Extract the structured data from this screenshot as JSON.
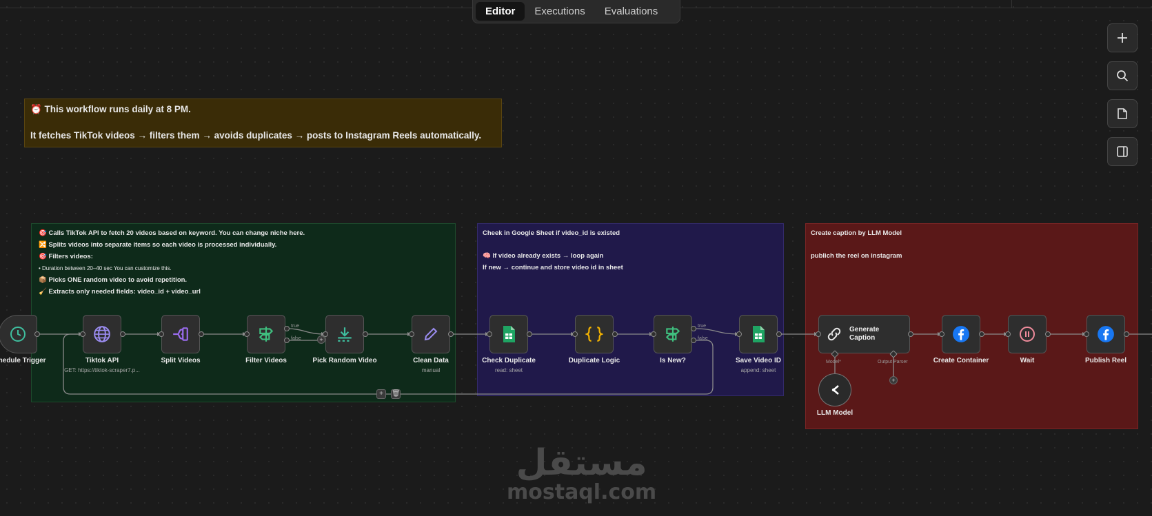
{
  "tabs": [
    {
      "label": "Editor",
      "active": true
    },
    {
      "label": "Executions",
      "active": false
    },
    {
      "label": "Evaluations",
      "active": false
    }
  ],
  "right_toolbar": [
    "plus-icon",
    "search-icon",
    "sticky-note-icon",
    "panel-icon"
  ],
  "notes": {
    "top": {
      "line1": "⏰ This workflow runs daily at 8 PM.",
      "line2": "It fetches TikTok videos → filters them → avoids duplicates → posts to Instagram Reels automatically."
    },
    "green": {
      "l1": "🎯 Calls TikTok API to fetch 20 videos based on keyword. You can change niche here.",
      "l2": "🔀 Splits videos into separate items so each video is processed individually.",
      "l3": "🎯 Filters videos:",
      "l4": "•  Duration between 20–40 sec You can customize this.",
      "l5": "📦 Picks ONE random video to avoid repetition.",
      "l6": "🧹 Extracts only needed fields: video_id + video_url"
    },
    "blue": {
      "l1": "Cheek in Google Sheet if video_id is existed",
      "l2": "🧠 If video already exists → loop again",
      "l3": "If new → continue and store video id in sheet"
    },
    "red": {
      "l1": "Create caption by LLM Model",
      "l2": "publich the reel on instagram"
    }
  },
  "nodes": {
    "schedule": {
      "label": "Schedule Trigger",
      "icon": "clock-icon"
    },
    "tiktok": {
      "label": "Tiktok API",
      "sub": "GET: https://tiktok-scraper7.p...",
      "icon": "globe-icon"
    },
    "split": {
      "label": "Split Videos",
      "icon": "split-icon"
    },
    "filter": {
      "label": "Filter Videos",
      "icon": "signpost-icon",
      "true_label": "true",
      "false_label": "false"
    },
    "random": {
      "label": "Pick Random Video",
      "icon": "download-icon"
    },
    "clean": {
      "label": "Clean Data",
      "sub": "manual",
      "icon": "pencil-icon"
    },
    "check": {
      "label": "Check Duplicate",
      "sub": "read: sheet",
      "icon": "sheets-icon"
    },
    "dup": {
      "label": "Duplicate Logic",
      "icon": "code-braces-icon"
    },
    "isnew": {
      "label": "Is New?",
      "icon": "signpost-icon",
      "true_label": "true",
      "false_label": "false"
    },
    "save": {
      "label": "Save Video ID",
      "sub": "append: sheet",
      "icon": "sheets-icon"
    },
    "caption": {
      "label": "Generate Caption",
      "icon": "link-icon",
      "model_label": "Model*",
      "parser_label": "Output Parser"
    },
    "llm": {
      "label": "LLM Model",
      "icon": "llm-icon"
    },
    "container": {
      "label": "Create Container",
      "icon": "facebook-icon"
    },
    "wait": {
      "label": "Wait",
      "icon": "pause-icon"
    },
    "publish": {
      "label": "Publish Reel",
      "icon": "facebook-icon"
    }
  },
  "colors": {
    "facebook": "#1877f2",
    "sheets": "#1fa463",
    "code": "#f5b400",
    "signpost": "#3fbf7f",
    "split": "#9b6cf0",
    "pencil": "#9b8cf0",
    "globe": "#9b8cf0",
    "wait": "#f08c9c"
  },
  "watermark": {
    "arabic": "مستقل",
    "latin": "mostaql.com"
  }
}
